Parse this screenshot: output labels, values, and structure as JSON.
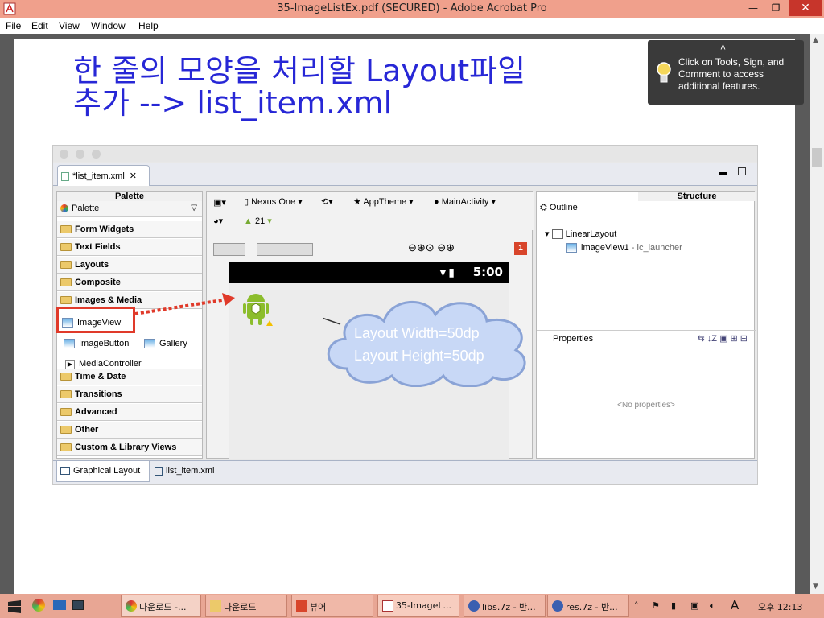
{
  "window": {
    "title": "35-ImageListEx.pdf (SECURED) - Adobe Acrobat Pro"
  },
  "menu": [
    "File",
    "Edit",
    "View",
    "Window",
    "Help"
  ],
  "slide": {
    "heading_line1": "한 줄의 모양을 처리할 Layout파일",
    "heading_line2": "추가 --> list_item.xml"
  },
  "tooltip": {
    "text": "Click on Tools, Sign, and Comment to access additional features."
  },
  "ide": {
    "file_tab": "*list_item.xml",
    "palette_header": "Palette",
    "palette_title": "Palette",
    "categories": [
      "Form Widgets",
      "Text Fields",
      "Layouts",
      "Composite",
      "Images & Media",
      "Time & Date",
      "Transitions",
      "Advanced",
      "Other",
      "Custom & Library Views"
    ],
    "media_items": [
      "ImageView",
      "ImageButton",
      "Gallery",
      "MediaController"
    ],
    "toolbar": {
      "device": "Nexus One",
      "theme": "AppTheme",
      "activity": "MainActivity",
      "api": "21"
    },
    "status_time": "5:00",
    "error_count": "1",
    "structure_header": "Structure",
    "outline_title": "Outline",
    "outline_root": "LinearLayout",
    "outline_child": "imageView1",
    "outline_child_src": " - ic_launcher",
    "properties_title": "Properties",
    "no_properties": "<No properties>",
    "bottom_tabs": [
      "Graphical Layout",
      "list_item.xml"
    ]
  },
  "callout": {
    "line1": "Layout Width=50dp",
    "line2": "Layout Height=50dp"
  },
  "taskbar": {
    "tasks": [
      "다운로드 -...",
      "다운로드",
      "뷰어",
      "35-ImageL...",
      "libs.7z - 반...",
      "res.7z - 반..."
    ],
    "ime": "A",
    "clock": "오후 12:13"
  },
  "colors": {
    "heading": "#2727d6",
    "accent_red": "#e03a2a",
    "cloud": "#c8d8f6",
    "titlebar": "#f0a08c"
  }
}
